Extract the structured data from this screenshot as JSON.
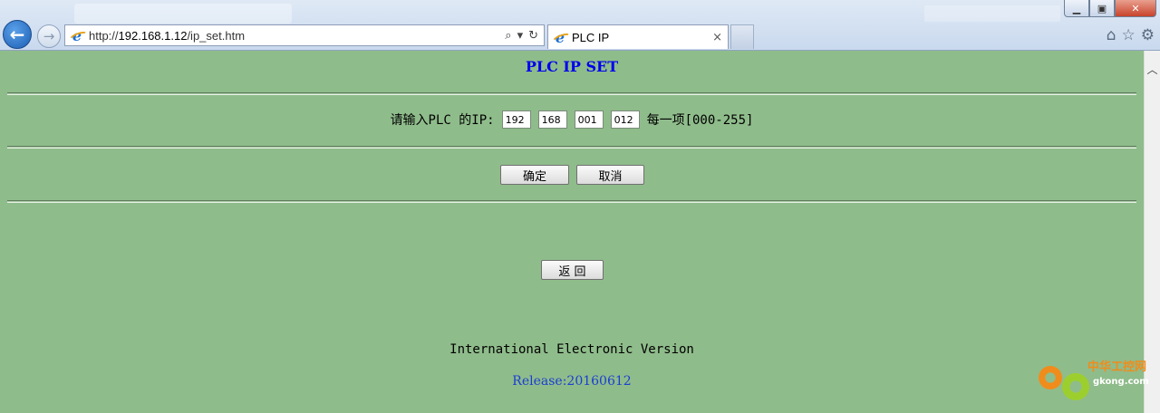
{
  "browser": {
    "url_prefix": "http://",
    "url_host": "192.168.1.12",
    "url_path": "/ip_set.htm",
    "tab_title": "PLC IP",
    "tab_close": "×",
    "window_buttons": {
      "minimize": "▁",
      "restore": "▣",
      "close": "✕"
    }
  },
  "page": {
    "title": "PLC IP SET",
    "ip_label": "请输入PLC 的IP:",
    "ip_fields": [
      "192",
      "168",
      "001",
      "012"
    ],
    "ip_hint": "每一项[000-255]",
    "confirm_label": "确定",
    "cancel_label": "取消",
    "back_label": "返 回",
    "footer_version": "International Electronic Version",
    "footer_release": "Release:20160612"
  },
  "watermark": {
    "name": "中华工控网",
    "domain": "gkong.com"
  }
}
